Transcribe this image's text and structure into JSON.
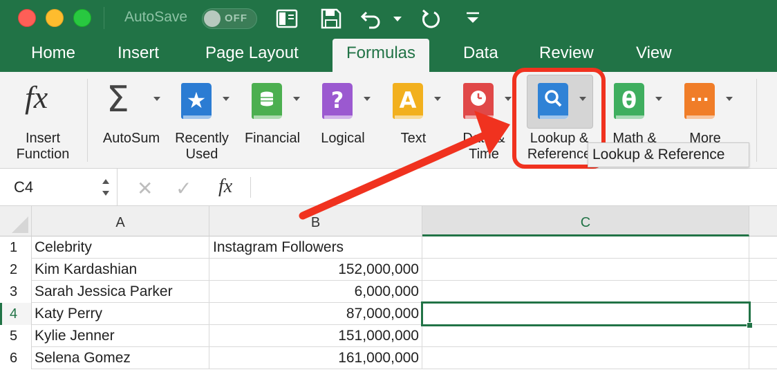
{
  "titlebar": {
    "autosave_label": "AutoSave",
    "autosave_state": "OFF"
  },
  "tabs": [
    {
      "label": "Home"
    },
    {
      "label": "Insert"
    },
    {
      "label": "Page Layout"
    },
    {
      "label": "Formulas",
      "active": true
    },
    {
      "label": "Data"
    },
    {
      "label": "Review"
    },
    {
      "label": "View"
    }
  ],
  "ribbon": {
    "insert_function": {
      "line1": "Insert",
      "line2": "Function",
      "icon": "fx"
    },
    "autosum": {
      "label": "AutoSum",
      "icon": "Σ"
    },
    "recently_used": {
      "line1": "Recently",
      "line2": "Used",
      "icon": "★"
    },
    "financial": {
      "label": "Financial"
    },
    "logical": {
      "label": "Logical",
      "icon": "?"
    },
    "text": {
      "label": "Text",
      "icon": "A"
    },
    "date_time": {
      "line1": "Date &",
      "line2": "Time"
    },
    "lookup": {
      "line1": "Lookup &",
      "line2": "Reference"
    },
    "math": {
      "line1": "Math &",
      "icon": "θ"
    },
    "more": {
      "line1": "More",
      "icon": "···"
    },
    "tooltip": "Lookup & Reference"
  },
  "formula_bar": {
    "name_box": "C4",
    "cancel_icon": "✕",
    "enter_icon": "✓",
    "fx_label": "fx",
    "value": ""
  },
  "sheet": {
    "columns": [
      "A",
      "B",
      "C"
    ],
    "rows": [
      {
        "num": "1",
        "a": "Celebrity",
        "b": "Instagram Followers"
      },
      {
        "num": "2",
        "a": "Kim Kardashian",
        "b": "152,000,000"
      },
      {
        "num": "3",
        "a": "Sarah Jessica Parker",
        "b": "6,000,000"
      },
      {
        "num": "4",
        "a": "Katy Perry",
        "b": "87,000,000"
      },
      {
        "num": "5",
        "a": "Kylie Jenner",
        "b": "151,000,000"
      },
      {
        "num": "6",
        "a": "Selena Gomez",
        "b": "161,000,000"
      }
    ],
    "selected_cell": "C4"
  },
  "colors": {
    "excel_green": "#217346",
    "annotation_red": "#f0321f",
    "financial_green": "#4caf50",
    "recently_used_blue": "#2b7cd3",
    "logical_purple": "#9b59d0",
    "text_yellow": "#f2b01e",
    "datetime_red": "#e04848",
    "lookup_blue": "#2f82d6",
    "math_green": "#3fae5f",
    "more_orange": "#f07d28"
  }
}
